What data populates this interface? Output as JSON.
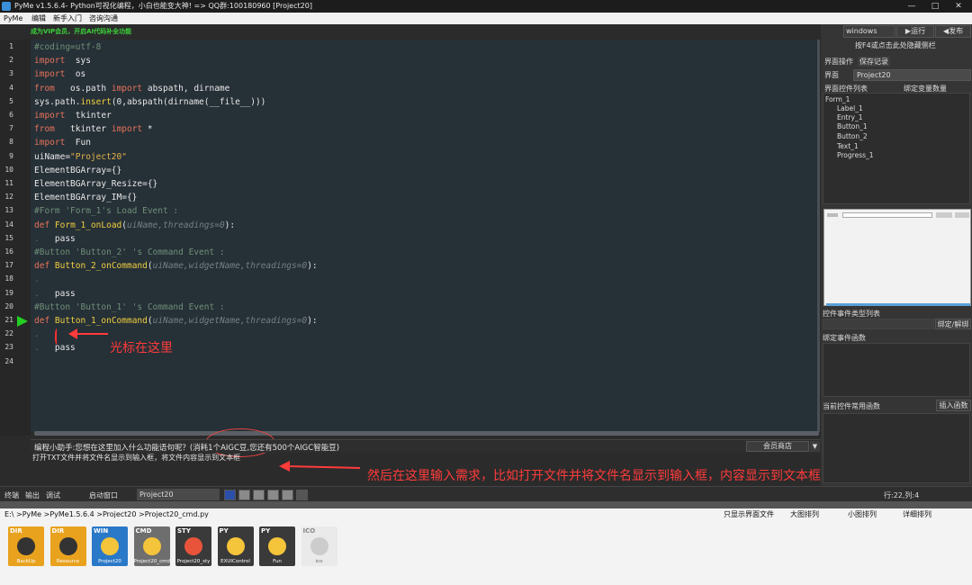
{
  "window": {
    "title": "PyMe v1.5.6.4- Python可视化编程，小白也能变大神!  => QQ群:100180960   [Project20]",
    "controls": [
      "—",
      "□",
      "✕"
    ]
  },
  "menu": [
    "PyMe",
    "编辑",
    "新手入门",
    "咨询沟通"
  ],
  "vip_banner": "成为VIP会员，开启AI代码补全功能",
  "editor": {
    "line_numbers": [
      "1",
      "2",
      "3",
      "4",
      "5",
      "6",
      "7",
      "8",
      "9",
      "10",
      "11",
      "12",
      "13",
      "14",
      "15",
      "16",
      "17",
      "18",
      "19",
      "20",
      "21",
      "22",
      "23",
      "24"
    ],
    "lines": [
      [
        [
          "cm",
          "#coding=utf-8"
        ]
      ],
      [
        [
          "kw",
          "import"
        ],
        [
          "",
          "  sys"
        ]
      ],
      [
        [
          "kw",
          "import"
        ],
        [
          "",
          "  os"
        ]
      ],
      [
        [
          "kw",
          "from"
        ],
        [
          "",
          "   os.path "
        ],
        [
          "kw",
          "import"
        ],
        [
          "",
          " abspath, dirname"
        ]
      ],
      [
        [
          "",
          "sys.path."
        ],
        [
          "fn",
          "insert"
        ],
        [
          "",
          "(0,abspath(dirname(__file__)))"
        ]
      ],
      [
        [
          "kw",
          "import"
        ],
        [
          "",
          "  tkinter"
        ]
      ],
      [
        [
          "kw",
          "from"
        ],
        [
          "",
          "   tkinter "
        ],
        [
          "kw",
          "import"
        ],
        [
          "",
          " *"
        ]
      ],
      [
        [
          "kw",
          "import"
        ],
        [
          "",
          "  Fun"
        ]
      ],
      [
        [
          "",
          "uiName="
        ],
        [
          "st",
          "\"Project20\""
        ]
      ],
      [
        [
          "",
          "ElementBGArray={}"
        ]
      ],
      [
        [
          "",
          "ElementBGArray_Resize={}"
        ]
      ],
      [
        [
          "",
          "ElementBGArray_IM={}"
        ]
      ],
      [
        [
          "cm",
          "#Form 'Form_1's Load Event :"
        ]
      ],
      [
        [
          "kw",
          "def"
        ],
        [
          "",
          " "
        ],
        [
          "fn",
          "Form_1_onLoad"
        ],
        [
          "",
          "("
        ],
        [
          "pm",
          "uiName,threadings=0"
        ],
        [
          "",
          "):"
        ]
      ],
      [
        [
          "dot",
          "."
        ],
        [
          "",
          "   pass"
        ]
      ],
      [
        [
          "cm",
          "#Button 'Button_2' 's Command Event :"
        ]
      ],
      [
        [
          "kw",
          "def"
        ],
        [
          "",
          " "
        ],
        [
          "fn",
          "Button_2_onCommand"
        ],
        [
          "",
          "("
        ],
        [
          "pm",
          "uiName,widgetName,threadings=0"
        ],
        [
          "",
          "):"
        ]
      ],
      [
        [
          "dot",
          "."
        ]
      ],
      [
        [
          "dot",
          "."
        ],
        [
          "",
          "   pass"
        ]
      ],
      [
        [
          "cm",
          "#Button 'Button_1' 's Command Event :"
        ]
      ],
      [
        [
          "kw",
          "def"
        ],
        [
          "",
          " "
        ],
        [
          "fn",
          "Button_1_onCommand"
        ],
        [
          "",
          "("
        ],
        [
          "pm",
          "uiName,widgetName,threadings=0"
        ],
        [
          "",
          "):"
        ]
      ],
      [
        [
          "dot",
          "."
        ]
      ],
      [
        [
          "dot",
          "."
        ],
        [
          "",
          "   pass"
        ]
      ],
      []
    ],
    "current_line": "21"
  },
  "annotations": {
    "cursor_here": "光标在这里",
    "input_hint": "然后在这里输入需求，比如打开文件并将文件名显示到输入框，内容显示到文本框"
  },
  "assistant": {
    "prompt": "编程小助手:您想在这里加入什么功能语句呢？(消耗1个AIGC豆,您还有500个AIGC智能豆)",
    "shop_button": "会员商店",
    "dropdown": "▼",
    "input_value": "打开TXT文件并将文件名显示到输入框，将文件内容显示到文本框"
  },
  "right_panel": {
    "platform": "windows",
    "run_button": "▶运行",
    "publish_button": "◀发布",
    "hint": "按F4或点击此处隐藏侧栏",
    "tabs": [
      "界面操作",
      "保存记录"
    ],
    "ui_label": "界面",
    "ui_value": "Project20",
    "controls_list_label": "界面控件列表",
    "bind_vars_label": "绑定变量数量",
    "tree": [
      "Form_1",
      "Label_1",
      "Entry_1",
      "Button_1",
      "Button_2",
      "Text_1",
      "Progress_1"
    ],
    "event_type_label": "控件事件类型列表",
    "bind_unbind_button": "绑定/解绑",
    "bound_events_label": "绑定事件函数",
    "common_funcs_label": "当前控件常用函数",
    "insert_func_button": "插入函数"
  },
  "bottom_tabs": {
    "tabs": [
      "终端",
      "输出",
      "调试"
    ],
    "start_window_label": "启动窗口",
    "start_window_value": "Project20",
    "cursor_pos": "行:22,列:4"
  },
  "path_bar": {
    "path": "E:\\ >PyMe >PyMe1.5.6.4 >Project20 >Project20_cmd.py",
    "options": [
      "只显示界面文件",
      "大图排列",
      "小图排列",
      "详细排列"
    ]
  },
  "files": [
    {
      "tag": "DIR",
      "name": "BackUp",
      "color": "#e8a21e"
    },
    {
      "tag": "DIR",
      "name": "Resource",
      "color": "#e8a21e"
    },
    {
      "tag": "WIN",
      "name": "Project20",
      "color": "#2a78c8"
    },
    {
      "tag": "CMD",
      "name": "Project20_cmd",
      "color": "#6e6e6e"
    },
    {
      "tag": "STY",
      "name": "Project20_sty",
      "color": "#3a3a3a"
    },
    {
      "tag": "PY",
      "name": "EXUIControl",
      "color": "#3a3a3a"
    },
    {
      "tag": "PY",
      "name": "Fun",
      "color": "#3a3a3a"
    },
    {
      "tag": "ICO",
      "name": "ico",
      "color": "#eaeaea"
    }
  ]
}
